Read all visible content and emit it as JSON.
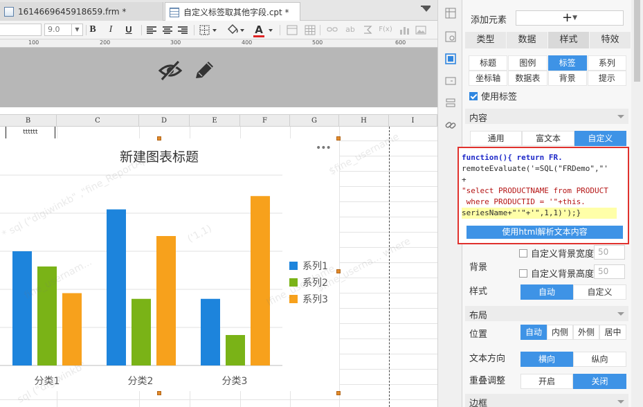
{
  "editor": {
    "tabs": [
      {
        "label": "1614669645918659.frm *"
      },
      {
        "label": "自定义标签取其他字段.cpt *"
      }
    ],
    "toolbar": {
      "font_size": "9.0",
      "bold": "B",
      "italic": "I",
      "underline": "U",
      "font_color": "A",
      "text_ab": "ab",
      "text_fx": "F(x)"
    },
    "ruler": [
      "100",
      "200",
      "300",
      "400",
      "500",
      "600"
    ],
    "columns": [
      "B",
      "C",
      "D",
      "E",
      "F",
      "G",
      "H",
      "I"
    ],
    "cell_b1": "tttttt"
  },
  "chart_data": {
    "type": "bar",
    "title": "新建图表标题",
    "categories": [
      "分类1",
      "分类2",
      "分类3"
    ],
    "series": [
      {
        "name": "系列1",
        "color": "#1d84dc",
        "values": [
          60,
          82,
          35
        ]
      },
      {
        "name": "系列2",
        "color": "#7ab317",
        "values": [
          52,
          35,
          16
        ]
      },
      {
        "name": "系列3",
        "color": "#f7a11c",
        "values": [
          38,
          68,
          89
        ]
      }
    ],
    "ylim": [
      0,
      100
    ],
    "legend": "right",
    "grid": true,
    "more_icon": "•••"
  },
  "watermarks": [
    "* sql (\"digiwinkb\" ,\"fine_ReportApp",
    "$fine_userna... where",
    "fine_usernam...",
    "$fine_username",
    "sql (\"digiwinkb\"",
    "('1,1)",
    "Ifine_userName"
  ],
  "panel": {
    "add_label": "添加元素",
    "add_button": "+",
    "main_tabs": [
      {
        "label": "类型",
        "active": false
      },
      {
        "label": "数据",
        "active": false
      },
      {
        "label": "样式",
        "active": true
      },
      {
        "label": "特效",
        "active": false
      }
    ],
    "sub_tabs_row1": [
      {
        "label": "标题",
        "active": false
      },
      {
        "label": "图例",
        "active": false
      },
      {
        "label": "标签",
        "active": true
      },
      {
        "label": "系列",
        "active": false
      }
    ],
    "sub_tabs_row2": [
      {
        "label": "坐标轴",
        "active": false
      },
      {
        "label": "数据表",
        "active": false
      },
      {
        "label": "背景",
        "active": false
      },
      {
        "label": "提示",
        "active": false
      }
    ],
    "use_label": "使用标签",
    "content_section": "内容",
    "mode_tabs": [
      {
        "label": "通用",
        "active": false
      },
      {
        "label": "富文本",
        "active": false
      },
      {
        "label": "自定义",
        "active": true
      }
    ],
    "code_lines": [
      "function(){ return FR.",
      "remoteEvaluate('=SQL(\"FRDemo\",\"'",
      "+",
      "\"select PRODUCTNAME from PRODUCT",
      " where PRODUCTID = '\"+this.",
      "seriesName+\"'\"+'\",1,1)');}"
    ],
    "parse_html": "使用html解析文本内容",
    "background_label": "背景",
    "custom_bg_width": "自定义背景宽度",
    "custom_bg_height": "自定义背景高度",
    "bg_width_value": "50",
    "bg_height_value": "50",
    "style_label": "样式",
    "style_options": [
      {
        "label": "自动",
        "active": true
      },
      {
        "label": "自定义",
        "active": false
      }
    ],
    "layout_section": "布局",
    "position_label": "位置",
    "position_options": [
      {
        "label": "自动",
        "active": true
      },
      {
        "label": "内侧",
        "active": false
      },
      {
        "label": "外侧",
        "active": false
      },
      {
        "label": "居中",
        "active": false
      }
    ],
    "text_dir_label": "文本方向",
    "text_dir_options": [
      {
        "label": "横向",
        "active": true
      },
      {
        "label": "纵向",
        "active": false
      }
    ],
    "overlap_label": "重叠调整",
    "overlap_options": [
      {
        "label": "开启",
        "active": false
      },
      {
        "label": "关闭",
        "active": true
      }
    ],
    "border_section": "边框"
  }
}
